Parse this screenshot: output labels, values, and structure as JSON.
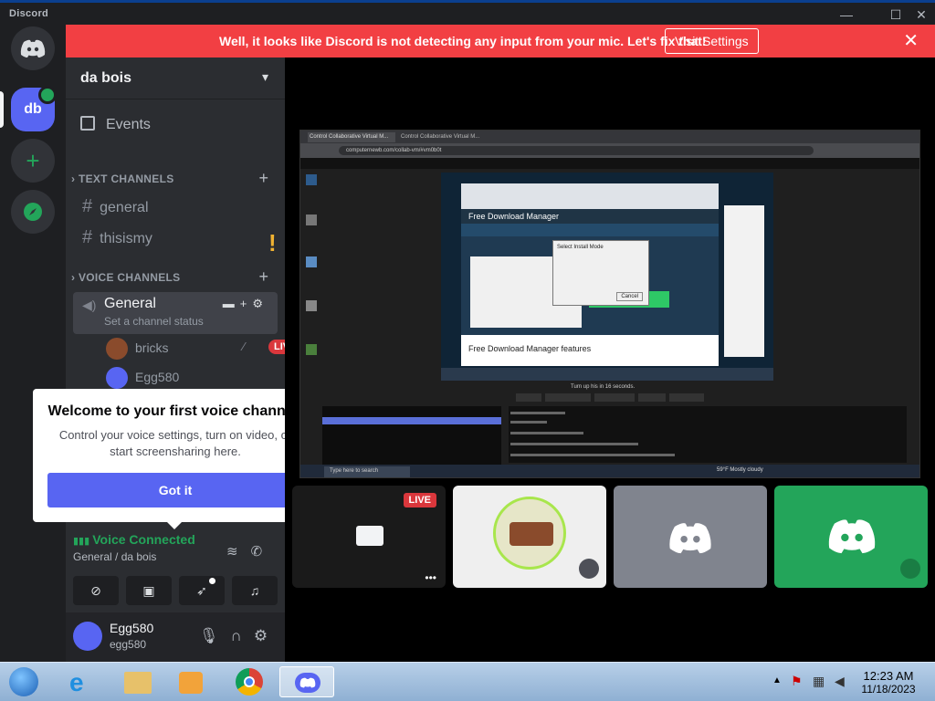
{
  "window": {
    "app_name": "Discord",
    "minimize": "—",
    "maximize": "☐",
    "close": "✕"
  },
  "banner": {
    "message": "Well, it looks like Discord is not detecting any input from your mic. Let's fix that!",
    "action": "Visit Settings",
    "close": "✕"
  },
  "rail": {
    "server_initials": "db"
  },
  "server": {
    "name": "da bois",
    "events_label": "Events",
    "text_category": "TEXT CHANNELS",
    "text_channels": [
      "general",
      "thisismy"
    ],
    "voice_category": "VOICE CHANNELS",
    "voice_channel": {
      "name": "General",
      "status_placeholder": "Set a channel status",
      "users": [
        {
          "name": "bricks",
          "badge": "LIVE"
        },
        {
          "name": "Egg580"
        }
      ]
    }
  },
  "popup": {
    "title": "Welcome to your first voice channel!",
    "body": "Control your voice settings, turn on video, or start screensharing here.",
    "button": "Got it"
  },
  "voice_status": {
    "title": "Voice Connected",
    "location": "General / da bois"
  },
  "user": {
    "display_name": "Egg580",
    "username": "egg580"
  },
  "stage": {
    "live_badge": "LIVE",
    "stream_menu": "•••",
    "inner_browser": {
      "tab1": "Control Collaborative Virtual M...",
      "tab2": "Control Collaborative Virtual M...",
      "url": "computernewb.com/collab-vm/#vm0b0t",
      "site_title": "Free Download Manager",
      "features_heading": "Free Download Manager features",
      "turn_text": "Turn up his in 16 seconds.",
      "search_text": "Type here to search",
      "weather": "59°F Mostly cloudy",
      "dialog_title": "Select Install Mode",
      "cancel": "Cancel"
    }
  },
  "taskbar": {
    "time": "12:23 AM",
    "date": "11/18/2023"
  },
  "colors": {
    "blurple": "#5865f2",
    "danger": "#f23f43",
    "green": "#23a55a",
    "sidebar": "#2b2d31",
    "rail": "#1e1f22"
  }
}
